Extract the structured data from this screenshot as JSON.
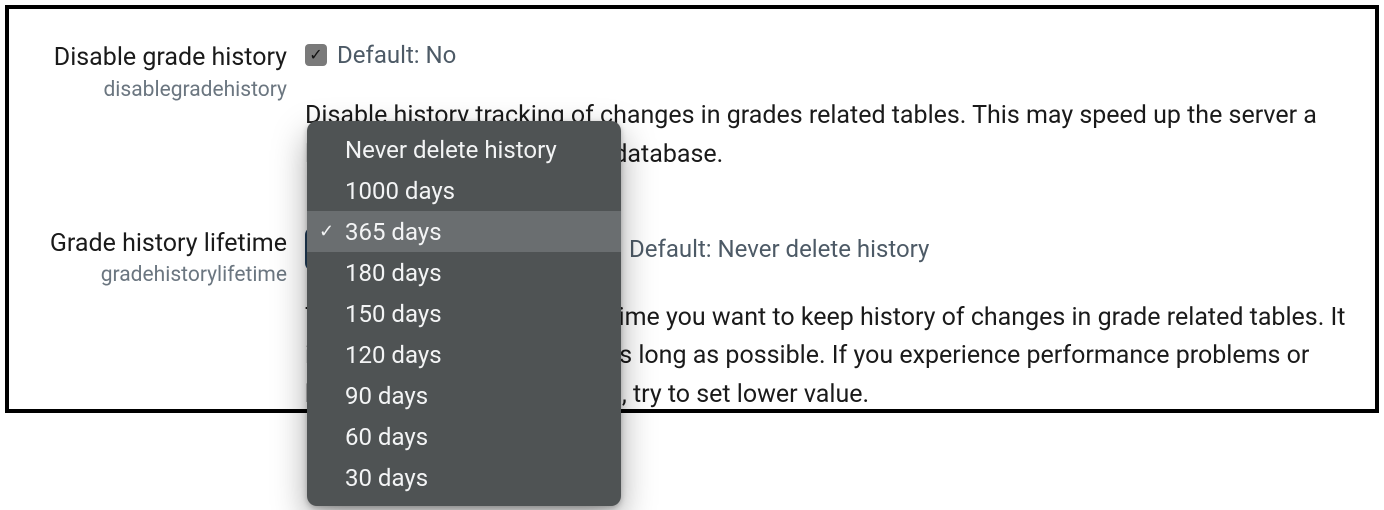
{
  "settings": [
    {
      "title": "Disable grade history",
      "key": "disablegradehistory",
      "checkbox_checked": true,
      "default_label": "Default: No",
      "description": "Disable history tracking of changes in grades related tables. This may speed up the server a little and conserve space in database."
    },
    {
      "title": "Grade history lifetime",
      "key": "gradehistorylifetime",
      "default_label": "Default: Never delete history",
      "description": "This specifies the length of time you want to keep history of changes in grade related tables. It is recommended to keep it as long as possible. If you experience performance problems or have limited database space, try to set lower value."
    }
  ],
  "dropdown": {
    "selected_index": 2,
    "options": [
      "Never delete history",
      "1000 days",
      "365 days",
      "180 days",
      "150 days",
      "120 days",
      "90 days",
      "60 days",
      "30 days"
    ]
  }
}
